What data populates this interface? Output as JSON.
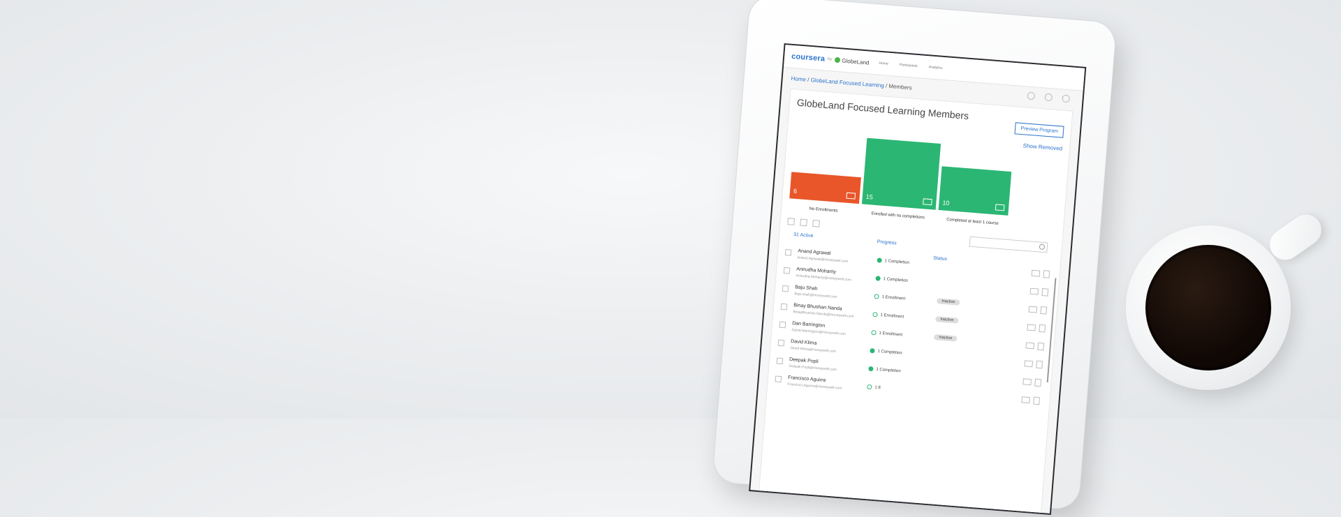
{
  "app": {
    "brand": "coursera",
    "brand_by": "by",
    "partner": "GlobeLand",
    "nav": [
      "Home",
      "Participants",
      "Analytics"
    ]
  },
  "breadcrumb": {
    "home": "Home",
    "program": "GlobeLand Focused Learning",
    "current": "Members"
  },
  "page": {
    "title": "GlobeLand Focused Learning Members",
    "preview_button": "Preview Program",
    "show_removed": "Show Removed"
  },
  "chart_data": {
    "type": "bar",
    "categories": [
      "No Enrollments",
      "Enrolled with no completions",
      "Completed at least 1 course"
    ],
    "values": [
      6,
      15,
      10
    ],
    "colors": [
      "#e8562a",
      "#2bb673",
      "#2bb673"
    ]
  },
  "list": {
    "active_label": "31 Active",
    "progress_header": "Progress",
    "status_header": "Status",
    "members": [
      {
        "name": "Anand Agrawal",
        "email": "Anand.Agrawal@Honeywell.com",
        "progress": "1 Completion",
        "status": ""
      },
      {
        "name": "Anirudha Mohanty",
        "email": "Anirudha.Mohanty@Honeywell.com",
        "progress": "1 Completion",
        "status": ""
      },
      {
        "name": "Baju Shah",
        "email": "Baju.shah@Honeywell.com",
        "progress": "1 Enrollment",
        "status": "Inactive"
      },
      {
        "name": "Binay Bhushan Nanda",
        "email": "BinayBhushan.Nanda@Honeywell.com",
        "progress": "1 Enrollment",
        "status": "Inactive"
      },
      {
        "name": "Dan Barrington",
        "email": "Daniel.Barrington@Honeywell.com",
        "progress": "1 Enrollment",
        "status": "Inactive"
      },
      {
        "name": "David Klima",
        "email": "David.Klima@Honeywell.com",
        "progress": "1 Completion",
        "status": ""
      },
      {
        "name": "Deepak Popli",
        "email": "Deepak.Popli@Honeywell.com",
        "progress": "1 Completion",
        "status": ""
      },
      {
        "name": "Francisco Aguirre",
        "email": "Francisco.Aguirre@Honeywell.com",
        "progress": "1 E",
        "status": ""
      }
    ]
  },
  "colors": {
    "accent": "#2a73cc",
    "bar_orange": "#e8562a",
    "bar_green": "#2bb673"
  }
}
